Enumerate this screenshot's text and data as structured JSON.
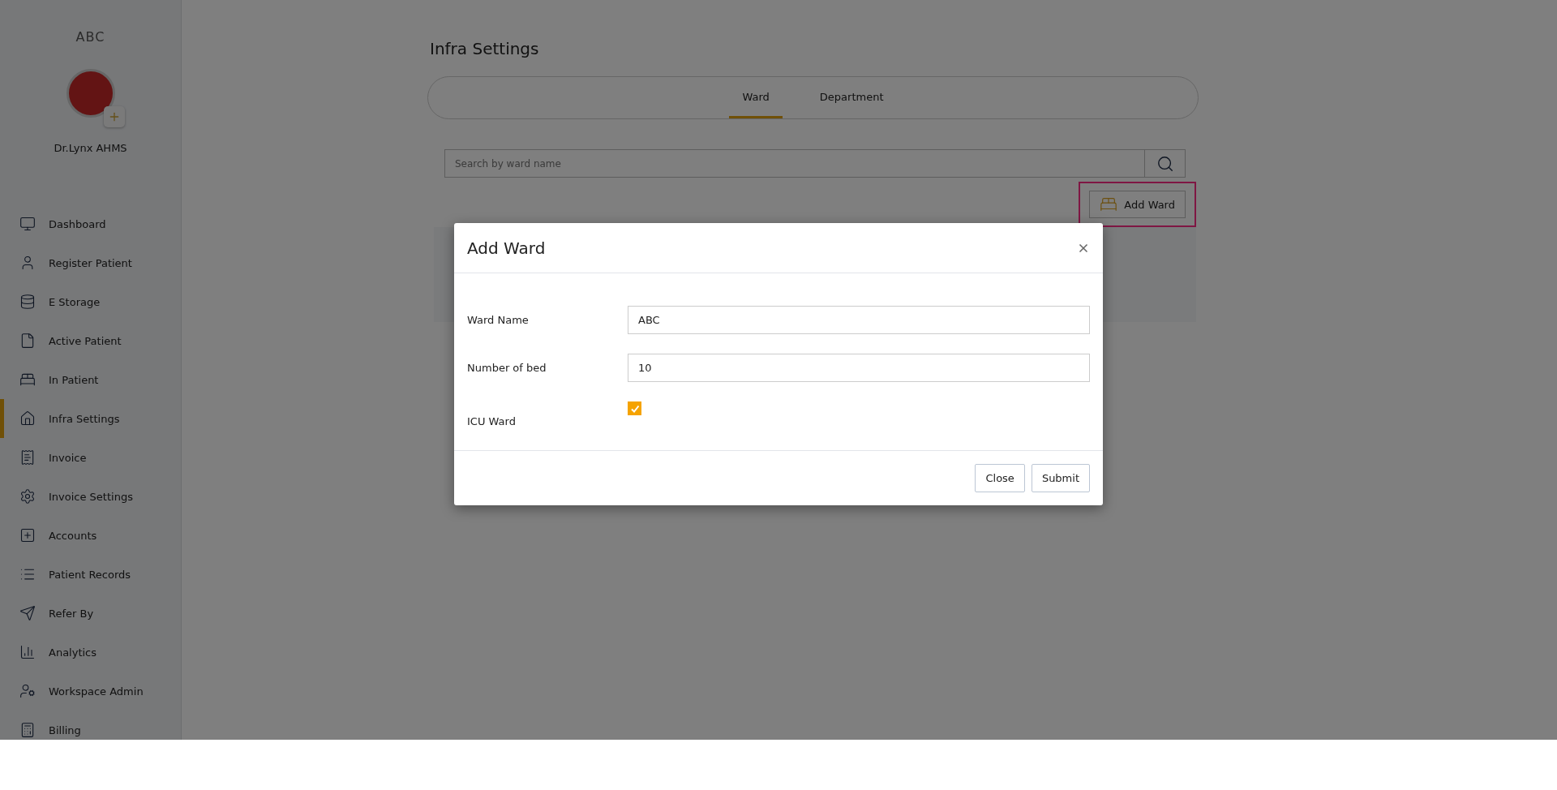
{
  "sidebar": {
    "org": "ABC",
    "user": "Dr.Lynx AHMS",
    "items": [
      {
        "label": "Dashboard",
        "selected": false
      },
      {
        "label": "Register Patient",
        "selected": false
      },
      {
        "label": "E Storage",
        "selected": false
      },
      {
        "label": "Active Patient",
        "selected": false
      },
      {
        "label": "In Patient",
        "selected": false
      },
      {
        "label": "Infra Settings",
        "selected": true
      },
      {
        "label": "Invoice",
        "selected": false
      },
      {
        "label": "Invoice Settings",
        "selected": false
      },
      {
        "label": "Accounts",
        "selected": false
      },
      {
        "label": "Patient Records",
        "selected": false
      },
      {
        "label": "Refer By",
        "selected": false
      },
      {
        "label": "Analytics",
        "selected": false
      },
      {
        "label": "Workspace Admin",
        "selected": false
      },
      {
        "label": "Billing",
        "selected": false
      }
    ]
  },
  "page": {
    "title": "Infra Settings",
    "tabs": [
      {
        "label": "Ward",
        "selected": true
      },
      {
        "label": "Department",
        "selected": false
      }
    ],
    "search": {
      "placeholder": "Search by ward name"
    },
    "add_button": "Add Ward"
  },
  "dialog": {
    "title": "Add Ward",
    "fields": [
      {
        "kind": "text",
        "label": "Ward Name",
        "value": "ABC"
      },
      {
        "kind": "text",
        "label": "Number of bed",
        "value": "10"
      },
      {
        "kind": "checkbox",
        "label": "ICU Ward",
        "checked": true
      }
    ],
    "buttons": [
      "Close",
      "Submit"
    ]
  }
}
